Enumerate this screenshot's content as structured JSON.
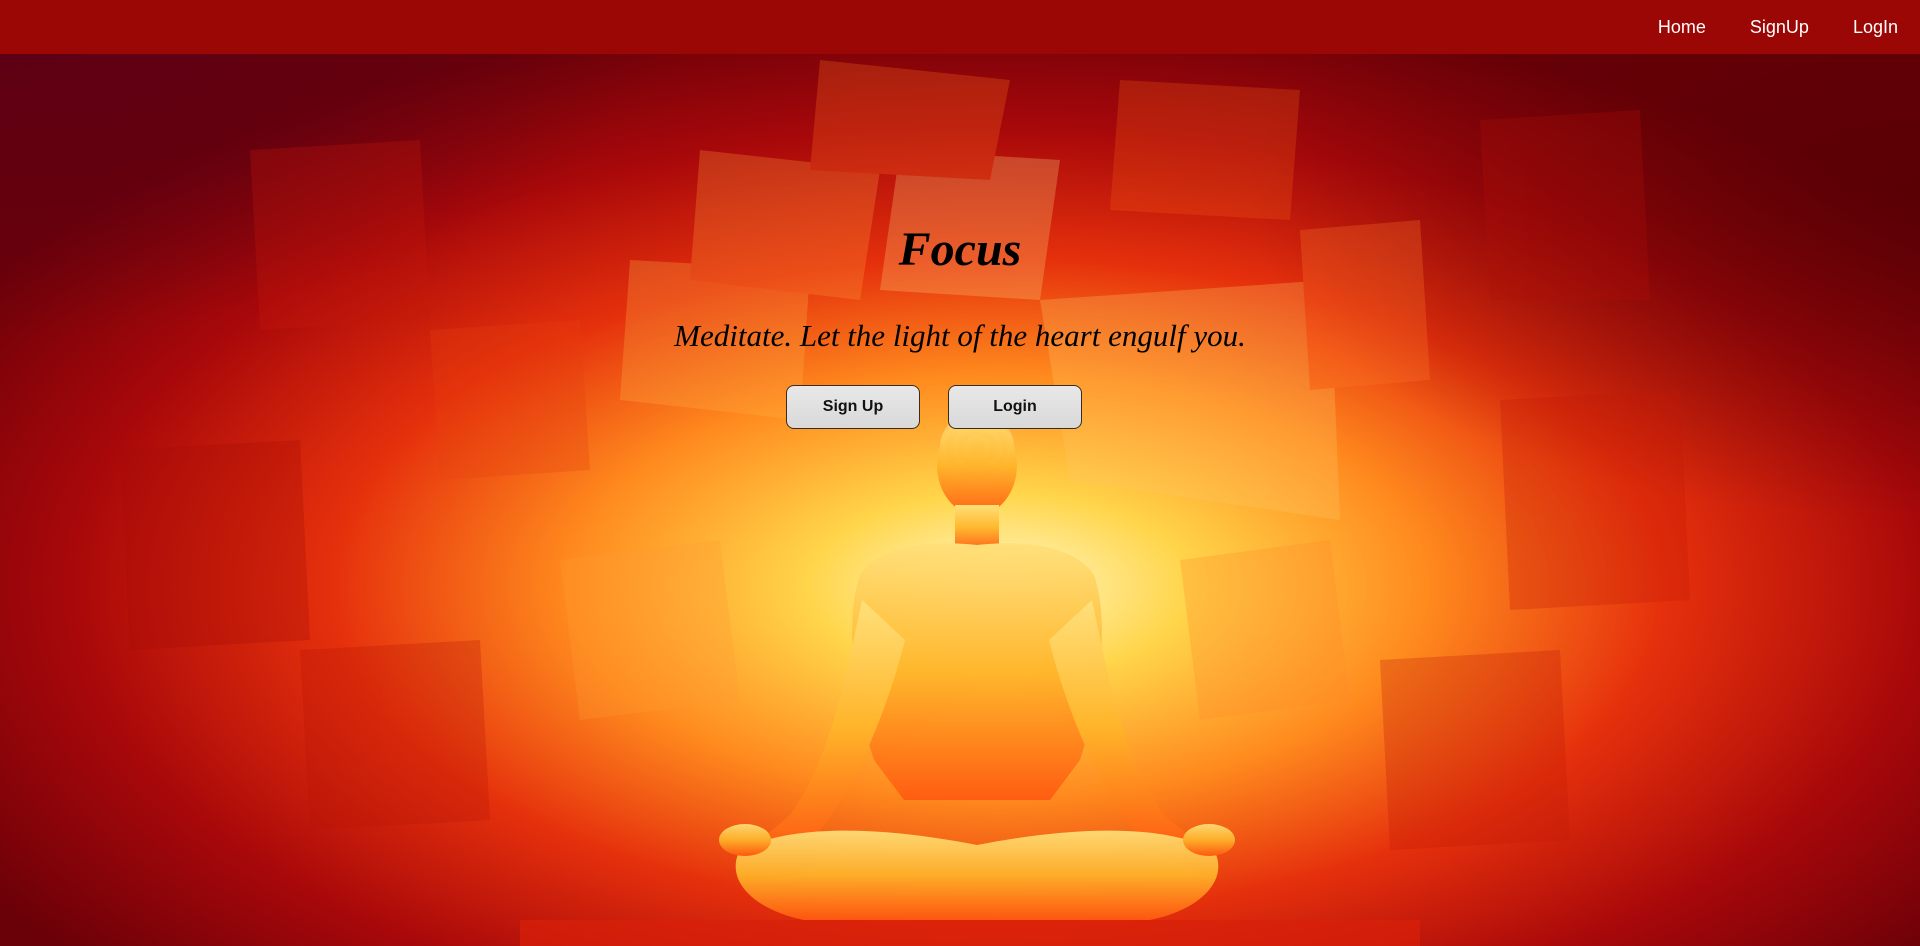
{
  "colors": {
    "navbar": "#9a0704",
    "background_dark": "#7a0004",
    "background_glow": "#fff2b0",
    "text": "#000000",
    "nav_text": "#ffffff",
    "button_bg": "#dedede"
  },
  "nav": {
    "items": [
      {
        "label": "Home"
      },
      {
        "label": "SignUp"
      },
      {
        "label": "LogIn"
      }
    ]
  },
  "hero": {
    "title": "Focus",
    "subtitle": "Meditate. Let the light of the heart engulf you.",
    "signup_label": "Sign Up",
    "login_label": "Login"
  },
  "background": {
    "icon": "meditating-figure-silhouette"
  }
}
